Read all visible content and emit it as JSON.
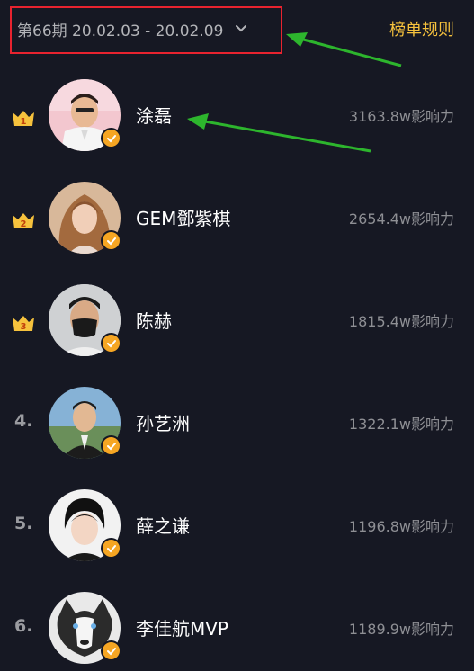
{
  "header": {
    "period_label": "第66期 20.02.03 - 20.02.09",
    "rules_link": "榜单规则"
  },
  "entries": [
    {
      "rank": "1",
      "name": "涂磊",
      "score": "3163.8w影响力",
      "rank_style": "crown"
    },
    {
      "rank": "2",
      "name": "GEM鄧紫棋",
      "score": "2654.4w影响力",
      "rank_style": "crown"
    },
    {
      "rank": "3",
      "name": "陈赫",
      "score": "1815.4w影响力",
      "rank_style": "crown"
    },
    {
      "rank": "4.",
      "name": "孙艺洲",
      "score": "1322.1w影响力",
      "rank_style": "number"
    },
    {
      "rank": "5.",
      "name": "薛之谦",
      "score": "1196.8w影响力",
      "rank_style": "number"
    },
    {
      "rank": "6.",
      "name": "李佳航MVP",
      "score": "1189.9w影响力",
      "rank_style": "number"
    }
  ],
  "colors": {
    "background": "#161823",
    "crown_gold": "#f6c23d",
    "verified_badge": "#f6a623",
    "highlight_border": "#e8232f",
    "annotation_arrow": "#2db52d"
  },
  "icons": {
    "period_dropdown": "chevron-down-icon",
    "crown": "crown-icon",
    "verified": "verified-check-icon"
  }
}
